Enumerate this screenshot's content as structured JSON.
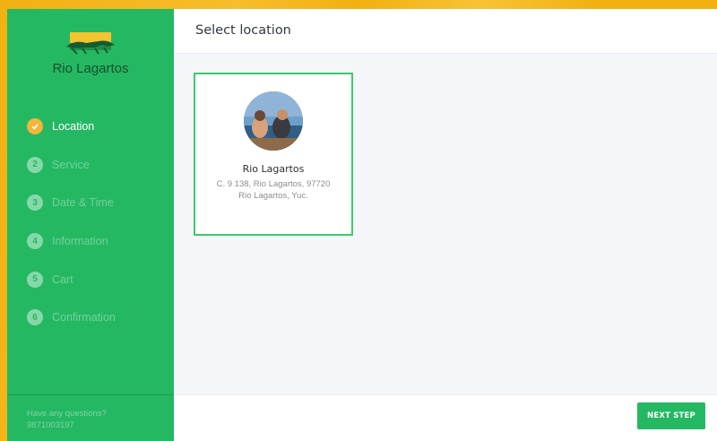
{
  "brand": {
    "name": "Rio Lagartos",
    "logo_icon": "crocodile-logo-icon"
  },
  "steps": [
    {
      "number": "",
      "label": "Location",
      "active": true,
      "icon": "checkmark-icon"
    },
    {
      "number": "2",
      "label": "Service"
    },
    {
      "number": "3",
      "label": "Date & Time"
    },
    {
      "number": "4",
      "label": "Information"
    },
    {
      "number": "5",
      "label": "Cart"
    },
    {
      "number": "6",
      "label": "Confirmation"
    }
  ],
  "sidebar_footer": {
    "question": "Have any questions?",
    "phone": "9871003197"
  },
  "header": {
    "title": "Select location"
  },
  "locations": [
    {
      "name": "Rio Lagartos",
      "address_line1": "C. 9 138, Rio Lagartos, 97720",
      "address_line2": "Rio Lagartos, Yuc."
    }
  ],
  "footer": {
    "next_label": "NEXT STEP"
  },
  "colors": {
    "sidebar": "#25b863",
    "active_step": "#f4b63a",
    "card_border": "#3fc86c",
    "backdrop": "#f2b111"
  }
}
